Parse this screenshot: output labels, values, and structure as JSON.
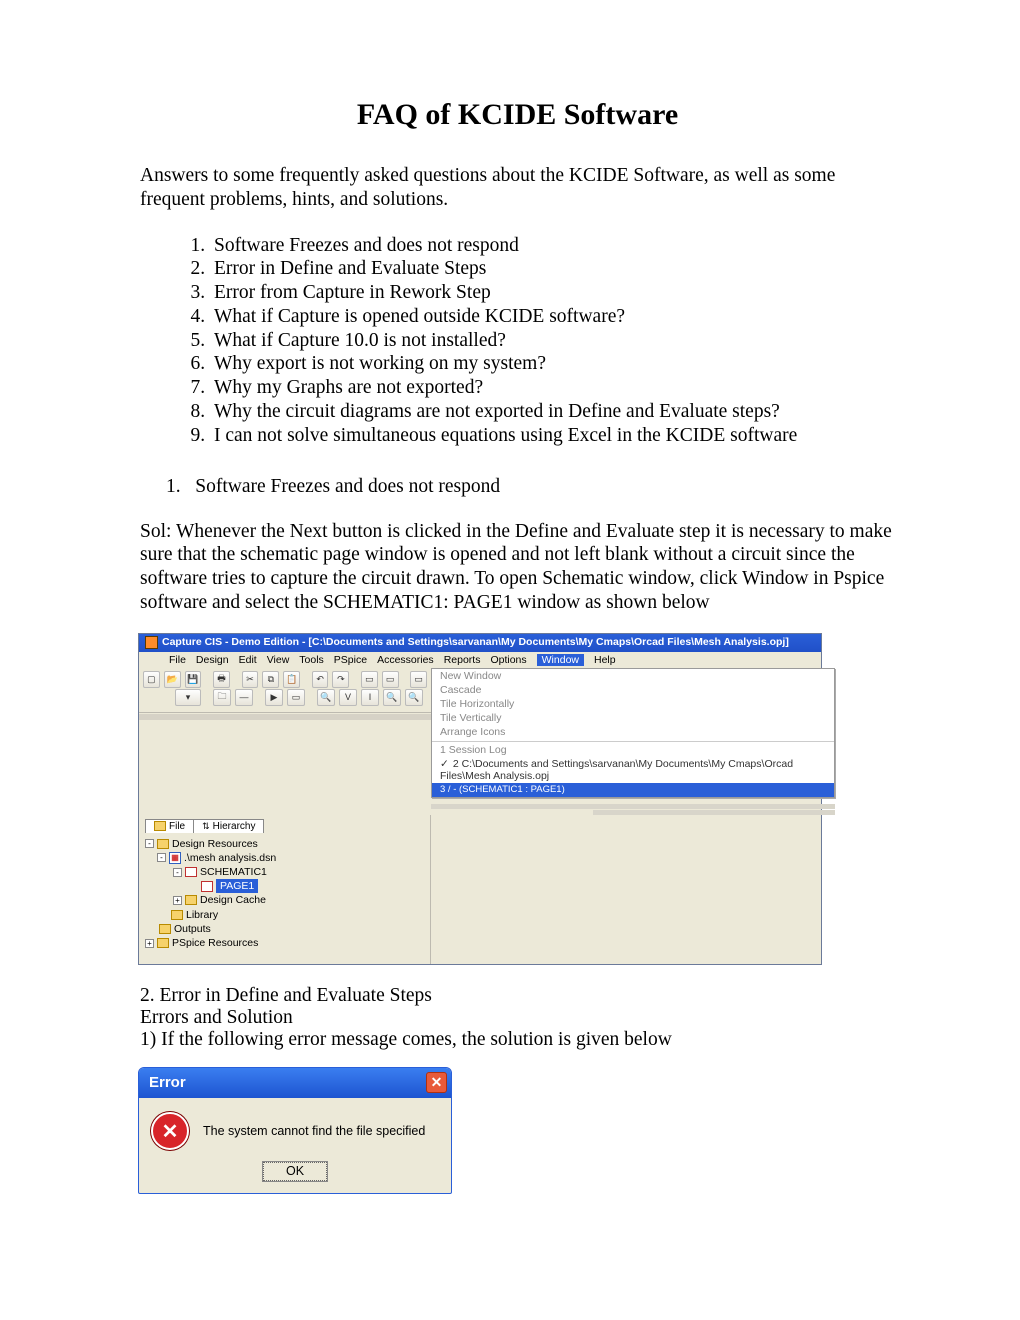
{
  "title": "FAQ of KCIDE Software",
  "intro": "Answers to some frequently asked questions about the KCIDE Software, as well as some frequent problems, hints, and solutions.",
  "faq_list": [
    "Software Freezes and does not respond",
    "Error in Define and Evaluate Steps",
    "Error from Capture in Rework Step",
    "What if Capture is opened outside KCIDE software?",
    "What if Capture 10.0 is not installed?",
    "Why export is not working on my system?",
    "Why my Graphs are not exported?",
    "Why the circuit diagrams are not exported in Define and Evaluate steps?",
    "I can not solve simultaneous equations using Excel in the KCIDE software"
  ],
  "q1": {
    "number": "1.",
    "heading": "Software Freezes and does not respond",
    "sol": "Sol: Whenever the Next button is clicked in the Define and Evaluate step it is necessary to make sure that the schematic page window is opened and not left blank without a circuit since the software tries to capture the circuit drawn. To open Schematic window, click Window in Pspice software and select the SCHEMATIC1: PAGE1 window as shown below"
  },
  "capture": {
    "title": "Capture CIS - Demo Edition - [C:\\Documents and Settings\\sarvanan\\My Documents\\My Cmaps\\Orcad Files\\Mesh Analysis.opj]",
    "menubar": {
      "items": [
        "File",
        "Design",
        "Edit",
        "View",
        "Tools",
        "PSpice",
        "Accessories",
        "Reports",
        "Options"
      ],
      "highlighted": "Window",
      "after": [
        "Help"
      ]
    },
    "tabs": {
      "file": "File",
      "hierarchy": "Hierarchy"
    },
    "tree": {
      "root": "Design Resources",
      "dsn": ".\\mesh analysis.dsn",
      "schem": "SCHEMATIC1",
      "page": "PAGE1",
      "cache": "Design Cache",
      "library": "Library",
      "outputs": "Outputs",
      "pspice": "PSpice Resources"
    },
    "window_menu": {
      "new_window": "New Window",
      "cascade": "Cascade",
      "tile_h": "Tile Horizontally",
      "tile_v": "Tile Vertically",
      "arrange": "Arrange Icons",
      "session": "1 Session Log",
      "doc2": "2 C:\\Documents and Settings\\sarvanan\\My Documents\\My Cmaps\\Orcad Files\\Mesh Analysis.opj",
      "doc3": "3 / - (SCHEMATIC1 : PAGE1)"
    }
  },
  "q2": {
    "head": "2.   Error in Define and Evaluate Steps",
    "sub1": "Errors and Solution",
    "sub2": "1) If the following error message comes, the solution is given below"
  },
  "error_dialog": {
    "title": "Error",
    "message": "The system cannot find the file specified",
    "ok": "OK"
  }
}
